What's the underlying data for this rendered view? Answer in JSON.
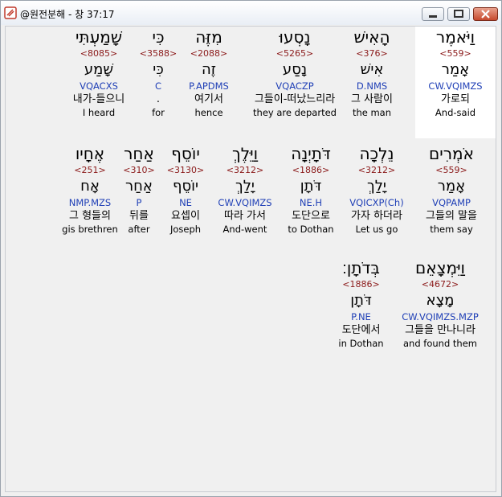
{
  "window": {
    "title": "@원전분해 - 창 37:17",
    "buttons": [
      "minimize",
      "maximize",
      "close"
    ]
  },
  "rows": [
    [
      {
        "heb": "וַיֹּאמֶר",
        "strong": "<559>",
        "root": "אָמַר",
        "parse": "CW.VQIMZS",
        "kor": "가로되",
        "eng": "And-said",
        "selected": true
      },
      {
        "heb": "הָאִישׁ",
        "strong": "<376>",
        "root": "אִישׁ",
        "parse": "D.NMS",
        "kor": "그 사람이",
        "eng": "the man"
      },
      {
        "heb": "נָסְעוּ",
        "strong": "<5265>",
        "root": "נָסַע",
        "parse": "VQACZP",
        "kor": "그들이-떠났느리라",
        "eng": "they are departed"
      },
      {
        "heb": "מִזֶּה",
        "strong": "<2088>",
        "root": "זֶה",
        "parse": "P.APDMS",
        "kor": "여기서",
        "eng": "hence"
      },
      {
        "heb": "כִּי",
        "strong": "<3588>",
        "root": "כִּי",
        "parse": "C",
        "kor": ".",
        "eng": "for"
      },
      {
        "heb": "שָׁמַעְתִּי",
        "strong": "<8085>",
        "root": "שָׁמַע",
        "parse": "VQACXS",
        "kor": "내가-들으니",
        "eng": "I heard"
      }
    ],
    [
      {
        "heb": "אֹמְרִים",
        "strong": "<559>",
        "root": "אָמַר",
        "parse": "VQPAMP",
        "kor": "그들의 말을",
        "eng": "them say"
      },
      {
        "heb": "נֵלְכָה",
        "strong": "<3212>",
        "root": "יָלַךְ",
        "parse": "VQICXP(Ch)",
        "kor": "가자 하더라",
        "eng": "Let us go"
      },
      {
        "heb": "דֹּתָיְנָה",
        "strong": "<1886>",
        "root": "דֹּתָן",
        "parse": "NE.H",
        "kor": "도단으로",
        "eng": "to Dothan"
      },
      {
        "heb": "וַיֵּלֶךְ",
        "strong": "<3212>",
        "root": "יָלַךְ",
        "parse": "CW.VQIMZS",
        "kor": "따라 가서",
        "eng": "And-went"
      },
      {
        "heb": "יוֹסֵף",
        "strong": "<3130>",
        "root": "יוֹסֵף",
        "parse": "NE",
        "kor": "요셉이",
        "eng": "Joseph"
      },
      {
        "heb": "אַחַר",
        "strong": "<310>",
        "root": "אַחַר",
        "parse": "P",
        "kor": "뒤를",
        "eng": "after"
      },
      {
        "heb": "אֶחָיו",
        "strong": "<251>",
        "root": "אָח",
        "parse": "NMP.MZS",
        "kor": "그 형들의",
        "eng": "gis brethren"
      }
    ],
    [
      {
        "heb": "וַיִּמְצָאֵם",
        "strong": "<4672>",
        "root": "מָצָא",
        "parse": "CW.VQIMZS.MZP",
        "kor": "그들을 만나니라",
        "eng": "and found them"
      },
      {
        "heb": "בְּדֹתָן׃",
        "strong": "<1886>",
        "root": "דֹּתָן",
        "parse": "P.NE",
        "kor": "도단에서",
        "eng": "in Dothan"
      }
    ]
  ]
}
